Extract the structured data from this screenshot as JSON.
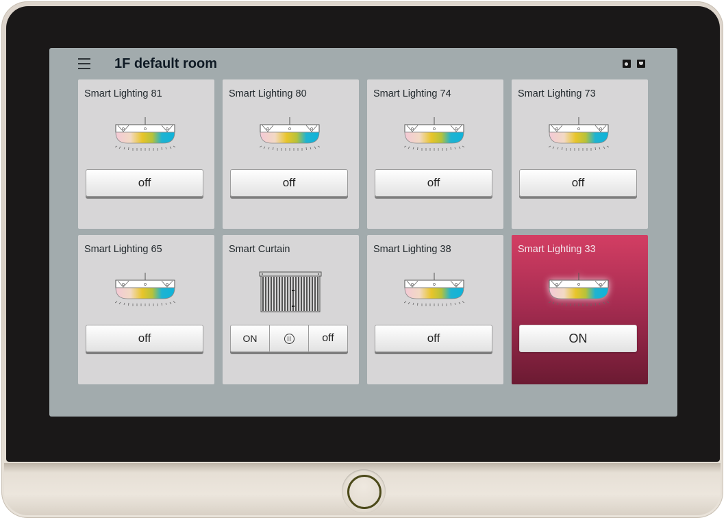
{
  "header": {
    "title": "1F default room",
    "icons": [
      "menu-icon",
      "speaker-icon",
      "shield-icon"
    ]
  },
  "devices": [
    {
      "name": "Smart Lighting 81",
      "type": "light",
      "state": "off",
      "button_label": "off"
    },
    {
      "name": "Smart Lighting 80",
      "type": "light",
      "state": "off",
      "button_label": "off"
    },
    {
      "name": "Smart Lighting 74",
      "type": "light",
      "state": "off",
      "button_label": "off"
    },
    {
      "name": "Smart Lighting 73",
      "type": "light",
      "state": "off",
      "button_label": "off"
    },
    {
      "name": "Smart Lighting 65",
      "type": "light",
      "state": "off",
      "button_label": "off"
    },
    {
      "name": "Smart Curtain",
      "type": "curtain",
      "controls": {
        "open_label": "ON",
        "pause_icon": "pause-icon",
        "close_label": "off"
      }
    },
    {
      "name": "Smart Lighting 38",
      "type": "light",
      "state": "off",
      "button_label": "off"
    },
    {
      "name": "Smart Lighting 33",
      "type": "light",
      "state": "on",
      "button_label": "ON"
    }
  ],
  "colors": {
    "screen_bg": "#a2abad",
    "card_bg": "#d7d6d7",
    "active_top": "#d33e63",
    "active_bottom": "#6b1a32",
    "bezel": "#1a1818",
    "frame": "#ddd5cc"
  }
}
